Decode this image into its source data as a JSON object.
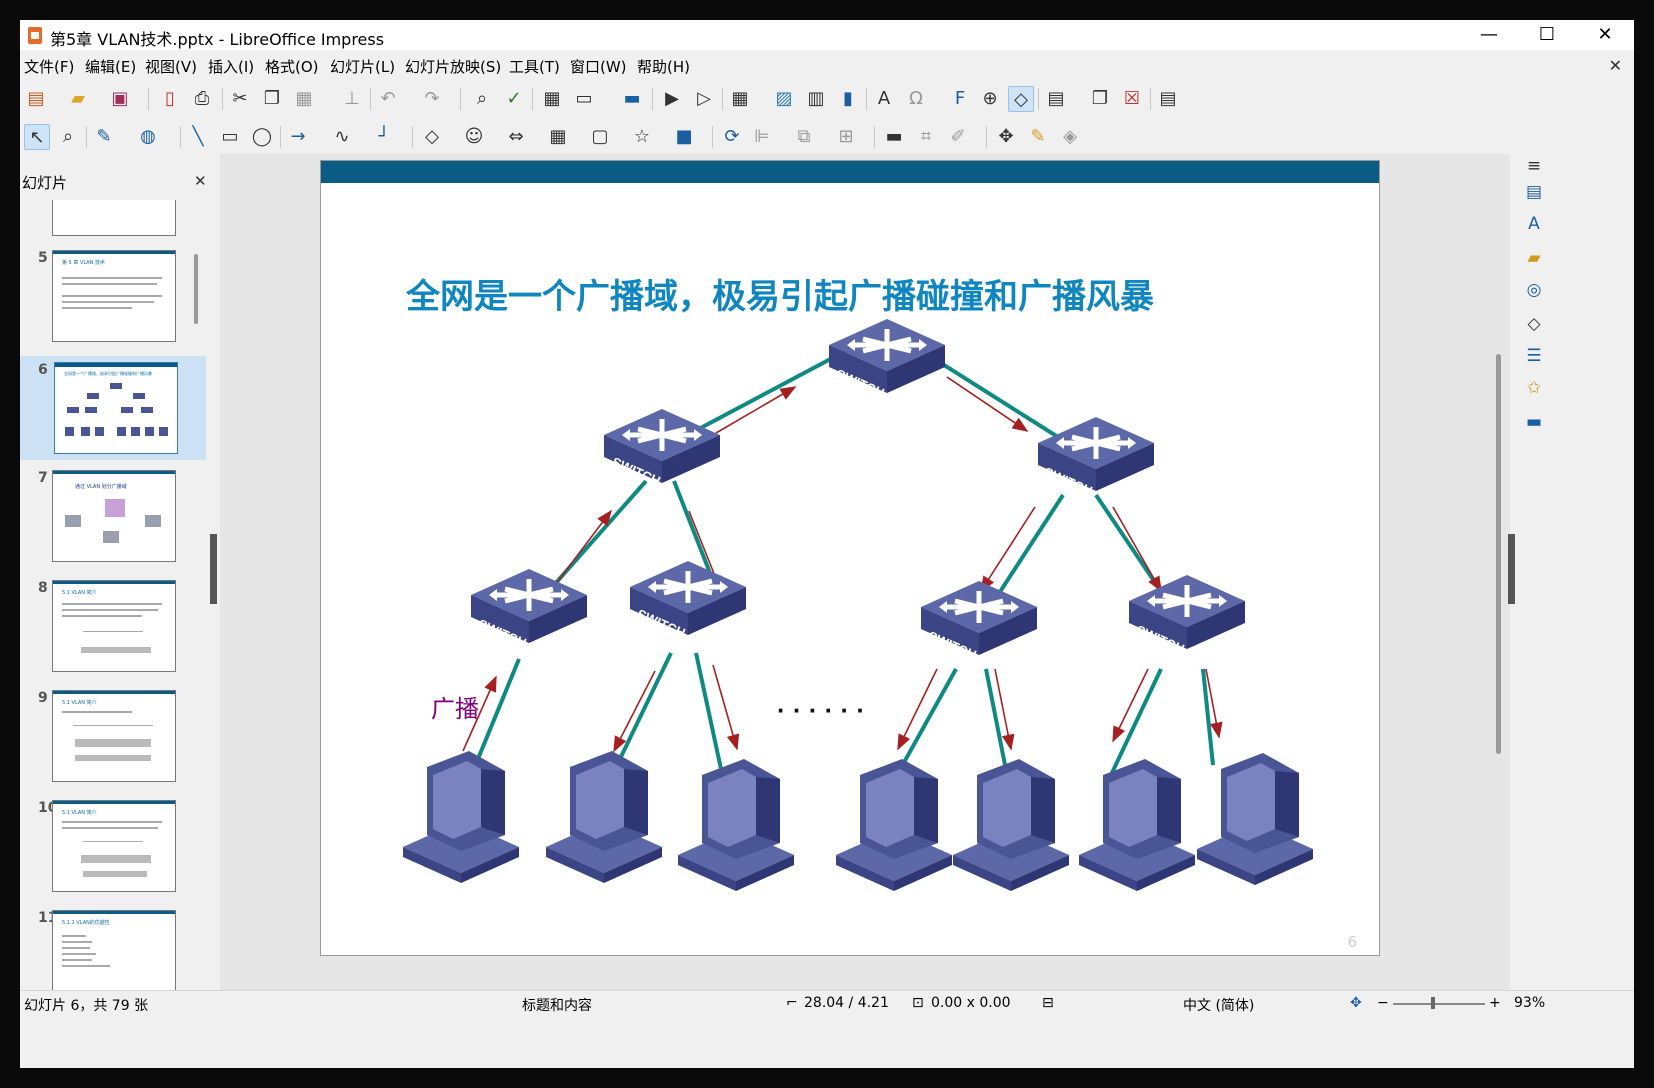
{
  "window": {
    "title": "第5章 VLAN技术.pptx - LibreOffice Impress",
    "minimize": "—",
    "maximize": "☐",
    "close": "✕"
  },
  "menu": [
    "文件(F)",
    "编辑(E)",
    "视图(V)",
    "插入(I)",
    "格式(O)",
    "幻灯片(L)",
    "幻灯片放映(S)",
    "工具(T)",
    "窗口(W)",
    "帮助(H)"
  ],
  "slides_panel": {
    "title": "幻灯片",
    "close": "✕",
    "thumbnails": [
      {
        "num": ""
      },
      {
        "num": "5",
        "title": "第 5 章  VLAN 技术"
      },
      {
        "num": "6",
        "title": "全网是一个广播域，极易引起广播碰撞和广播风暴",
        "selected": true
      },
      {
        "num": "7",
        "title": "通过 VLAN 划分广播域"
      },
      {
        "num": "8",
        "title": "5.1 VLAN 简介"
      },
      {
        "num": "9",
        "title": "5.1 VLAN 简介"
      },
      {
        "num": "10",
        "title": "5.1 VLAN 简介"
      },
      {
        "num": "11",
        "title": "5.1.1 VLAN的优越性"
      }
    ]
  },
  "slide": {
    "title": "全网是一个广播域，极易引起广播碰撞和广播风暴",
    "switch_label": "SWITCH",
    "broadcast_label": "广播",
    "ellipsis": "· · · · · ·",
    "page_number": "6",
    "colors": {
      "bar": "#0b5c85",
      "title": "#0f86c0",
      "link": "#0e8a82",
      "arrow": "#a52020",
      "device": "#4a5596",
      "broadcast": "#800080"
    }
  },
  "status": {
    "slide_info": "幻灯片 6，共 79 张",
    "layout": "标题和内容",
    "position": "28.04 / 4.21",
    "size": "0.00 x 0.00",
    "language": "中文 (简体)",
    "zoom": "93%"
  }
}
